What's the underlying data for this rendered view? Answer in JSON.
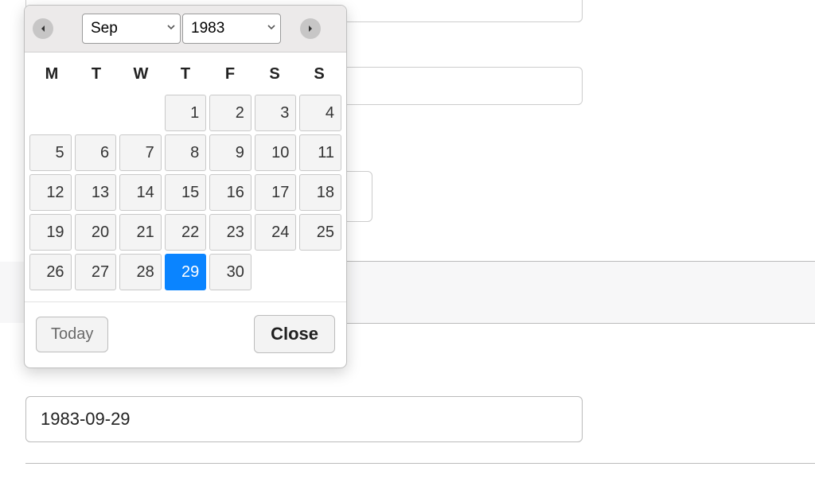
{
  "datepicker": {
    "month": "Sep",
    "year": "1983",
    "weekdays": [
      "M",
      "T",
      "W",
      "T",
      "F",
      "S",
      "S"
    ],
    "leading_blanks": 3,
    "days_in_month": 30,
    "selected_day": 29,
    "today_label": "Today",
    "close_label": "Close"
  },
  "input": {
    "value": "1983-09-29"
  }
}
